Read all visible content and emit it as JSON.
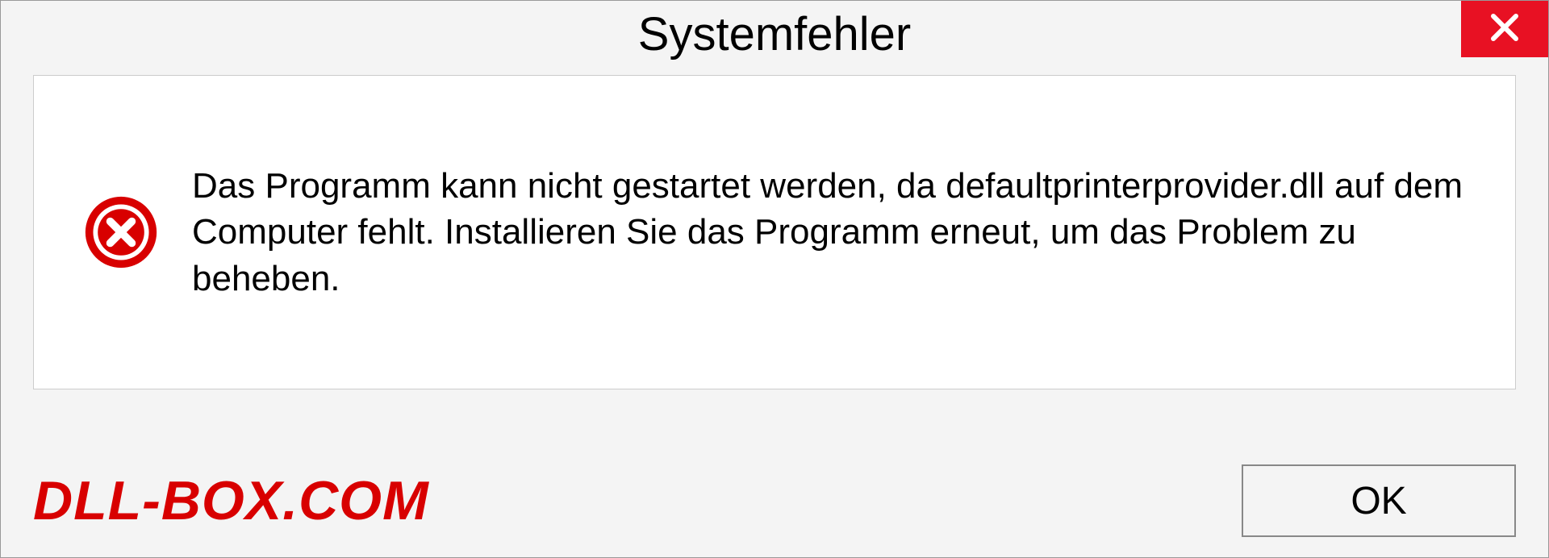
{
  "dialog": {
    "title": "Systemfehler",
    "message": "Das Programm kann nicht gestartet werden, da defaultprinterprovider.dll auf dem Computer fehlt. Installieren Sie das Programm erneut, um das Problem zu beheben.",
    "ok_label": "OK"
  },
  "watermark": "DLL-BOX.COM",
  "colors": {
    "close_red": "#e81123",
    "watermark_red": "#d80000",
    "panel_bg": "#f4f4f4"
  }
}
